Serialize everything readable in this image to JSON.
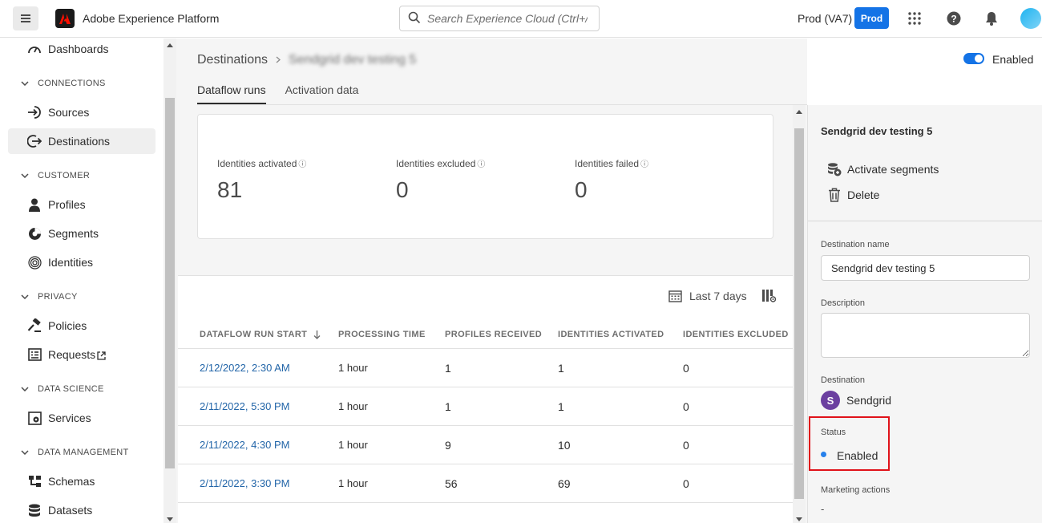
{
  "header": {
    "app_title": "Adobe Experience Platform",
    "search_placeholder": "Search Experience Cloud (Ctrl+/)",
    "org_name": "Prod (VA7)",
    "sandbox_badge": "Prod",
    "brand_color": "#fa0f00",
    "accent_color": "#1473e6"
  },
  "sidebar": {
    "items": [
      {
        "label": "Dashboards",
        "icon": "dashboard-icon"
      },
      {
        "section": "CONNECTIONS"
      },
      {
        "label": "Sources",
        "icon": "sources-icon"
      },
      {
        "label": "Destinations",
        "icon": "destinations-icon",
        "active": true
      },
      {
        "section": "CUSTOMER"
      },
      {
        "label": "Profiles",
        "icon": "profile-icon"
      },
      {
        "label": "Segments",
        "icon": "segments-icon"
      },
      {
        "label": "Identities",
        "icon": "fingerprint-icon"
      },
      {
        "section": "PRIVACY"
      },
      {
        "label": "Policies",
        "icon": "gavel-icon"
      },
      {
        "label": "Requests",
        "icon": "requests-icon",
        "external": true
      },
      {
        "section": "DATA SCIENCE"
      },
      {
        "label": "Services",
        "icon": "services-icon"
      },
      {
        "section": "DATA MANAGEMENT"
      },
      {
        "label": "Schemas",
        "icon": "schema-icon"
      },
      {
        "label": "Datasets",
        "icon": "datasets-icon"
      }
    ]
  },
  "main": {
    "breadcrumb_root": "Destinations",
    "breadcrumb_current": "Sendgrid dev testing 5",
    "enabled_toggle_label": "Enabled",
    "tabs": [
      {
        "label": "Dataflow runs",
        "active": true
      },
      {
        "label": "Activation data",
        "active": false
      }
    ],
    "metrics": [
      {
        "label": "Identities activated",
        "value": "81"
      },
      {
        "label": "Identities excluded",
        "value": "0"
      },
      {
        "label": "Identities failed",
        "value": "0"
      }
    ],
    "date_filter": "Last 7 days",
    "table": {
      "headers": [
        "DATAFLOW RUN START",
        "PROCESSING TIME",
        "PROFILES RECEIVED",
        "IDENTITIES ACTIVATED",
        "IDENTITIES EXCLUDED"
      ],
      "rows": [
        [
          "2/12/2022, 2:30 AM",
          "1 hour",
          "1",
          "1",
          "0"
        ],
        [
          "2/11/2022, 5:30 PM",
          "1 hour",
          "1",
          "1",
          "0"
        ],
        [
          "2/11/2022, 4:30 PM",
          "1 hour",
          "9",
          "10",
          "0"
        ],
        [
          "2/11/2022, 3:30 PM",
          "1 hour",
          "56",
          "69",
          "0"
        ]
      ]
    }
  },
  "panel": {
    "title": "Sendgrid dev testing 5",
    "actions": [
      {
        "label": "Activate segments",
        "icon": "activate-segments-icon"
      },
      {
        "label": "Delete",
        "icon": "trash-icon"
      }
    ],
    "destination_name_label": "Destination name",
    "destination_name_value": "Sendgrid dev testing 5",
    "description_label": "Description",
    "description_value": "",
    "destination_label": "Destination",
    "destination_avatar_letter": "S",
    "destination_value": "Sendgrid",
    "status_label": "Status",
    "status_value": "Enabled",
    "status_color": "#2680eb",
    "marketing_label": "Marketing actions",
    "marketing_value": "-"
  }
}
